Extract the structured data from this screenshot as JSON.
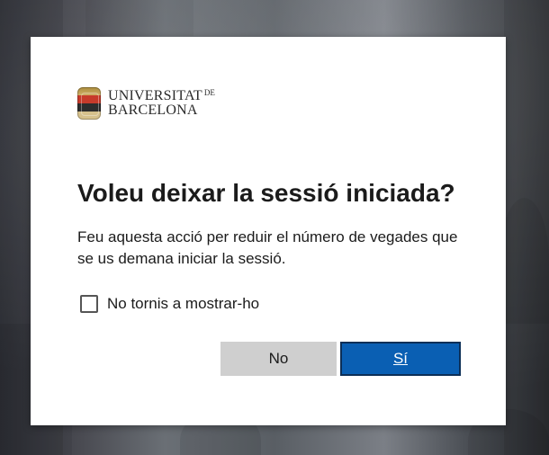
{
  "brand": {
    "logo_line1": "UNIVERSITAT",
    "logo_de": "DE",
    "logo_line2": "BARCELONA"
  },
  "dialog": {
    "title": "Voleu deixar la sessió iniciada?",
    "description": "Feu aquesta acció per reduir el número de vegades que se us demana iniciar la sessió.",
    "checkbox_label": "No tornis a mostrar-ho",
    "checkbox_checked": false,
    "no_label": "No",
    "yes_label": "Sí"
  },
  "colors": {
    "primary_button": "#0a5fb3",
    "secondary_button": "#cfcfcf"
  }
}
